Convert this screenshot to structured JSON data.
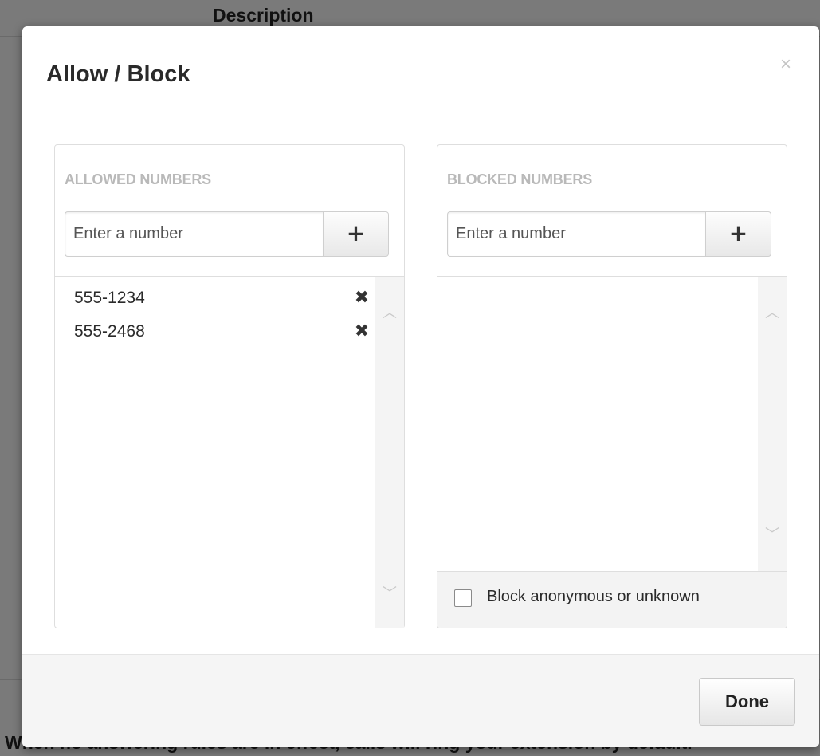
{
  "background": {
    "header_text": "Description",
    "bottom_text": "When no answering rules are in effect, calls will ring your extension by default."
  },
  "modal": {
    "title": "Allow / Block",
    "close_glyph": "×",
    "done_label": "Done"
  },
  "allowed": {
    "title": "ALLOWED NUMBERS",
    "input_placeholder": "Enter a number",
    "input_value": "",
    "add_glyph": "+",
    "items": [
      {
        "number": "555-1234",
        "remove_glyph": "✖"
      },
      {
        "number": "555-2468",
        "remove_glyph": "✖"
      }
    ]
  },
  "blocked": {
    "title": "BLOCKED NUMBERS",
    "input_placeholder": "Enter a number",
    "input_value": "",
    "add_glyph": "+",
    "items": [],
    "anonymous_label": "Block anonymous or unknown",
    "anonymous_checked": false
  },
  "scroll_glyphs": {
    "up": "︿",
    "down": "﹀"
  },
  "icons": {
    "close": "close-icon",
    "add": "plus-icon",
    "remove": "remove-x-icon",
    "scroll_up": "chevron-up-icon",
    "scroll_down": "chevron-down-icon"
  }
}
